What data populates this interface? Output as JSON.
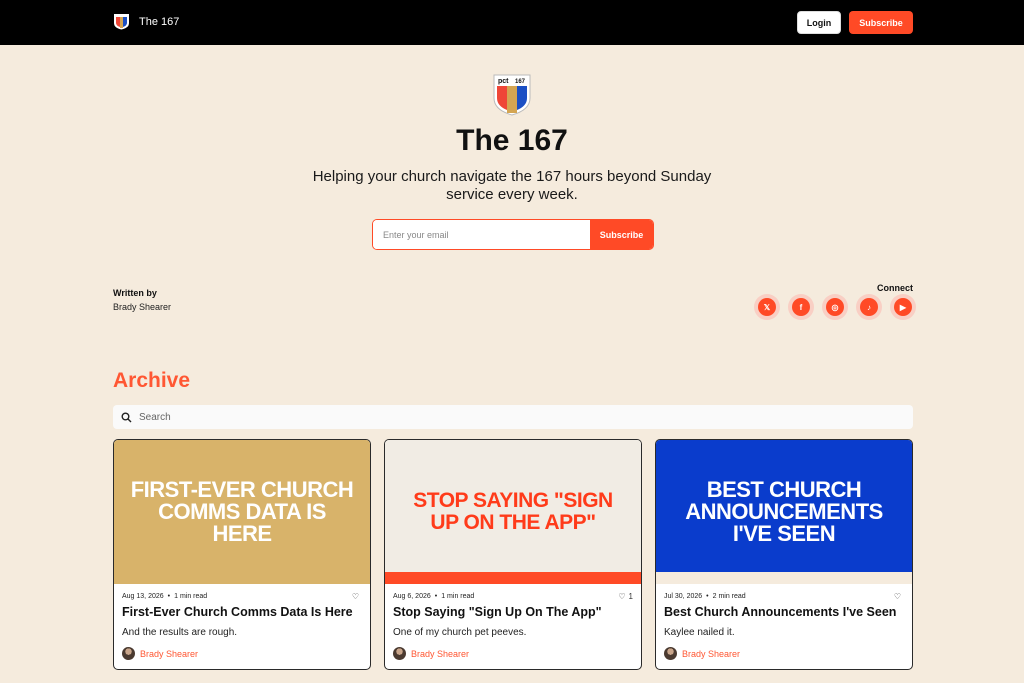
{
  "header": {
    "brand": "The 167",
    "login_label": "Login",
    "subscribe_label": "Subscribe"
  },
  "hero": {
    "logo_text_left": "pct",
    "logo_text_right": "167",
    "title": "The 167",
    "tagline": "Helping your church navigate the 167 hours beyond Sunday service every week.",
    "email_placeholder": "Enter your email",
    "subscribe_label": "Subscribe"
  },
  "author": {
    "written_by_label": "Written by",
    "name": "Brady Shearer"
  },
  "connect": {
    "label": "Connect",
    "socials": [
      {
        "icon": "x-icon",
        "glyph": "𝕏"
      },
      {
        "icon": "facebook-icon",
        "glyph": "f"
      },
      {
        "icon": "instagram-icon",
        "glyph": "◎"
      },
      {
        "icon": "tiktok-icon",
        "glyph": "♪"
      },
      {
        "icon": "youtube-icon",
        "glyph": "▶"
      }
    ]
  },
  "archive": {
    "title": "Archive",
    "search_placeholder": "Search"
  },
  "posts": [
    {
      "image_text": "FIRST-EVER CHURCH COMMS DATA IS HERE",
      "date": "Aug 13, 2026",
      "read_time": "1 min read",
      "likes": "",
      "title": "First-Ever Church Comms Data Is Here",
      "subtitle": "And the results are rough.",
      "author": "Brady Shearer"
    },
    {
      "image_text": "STOP SAYING \"SIGN UP ON THE APP\"",
      "date": "Aug 6, 2026",
      "read_time": "1 min read",
      "likes": "1",
      "title": "Stop Saying \"Sign Up On The App\"",
      "subtitle": "One of my church pet peeves.",
      "author": "Brady Shearer"
    },
    {
      "image_text": "BEST CHURCH ANNOUNCEMENTS I'VE SEEN",
      "date": "Jul 30, 2026",
      "read_time": "2 min read",
      "likes": "",
      "title": "Best Church Announcements I've Seen",
      "subtitle": "Kaylee nailed it.",
      "author": "Brady Shearer"
    }
  ],
  "colors": {
    "accent": "#ff4a26",
    "background": "#f5ebdd",
    "card1_image": "#d8b36a",
    "card2_image": "#f1ece4",
    "card3_image": "#0a3ccc"
  }
}
